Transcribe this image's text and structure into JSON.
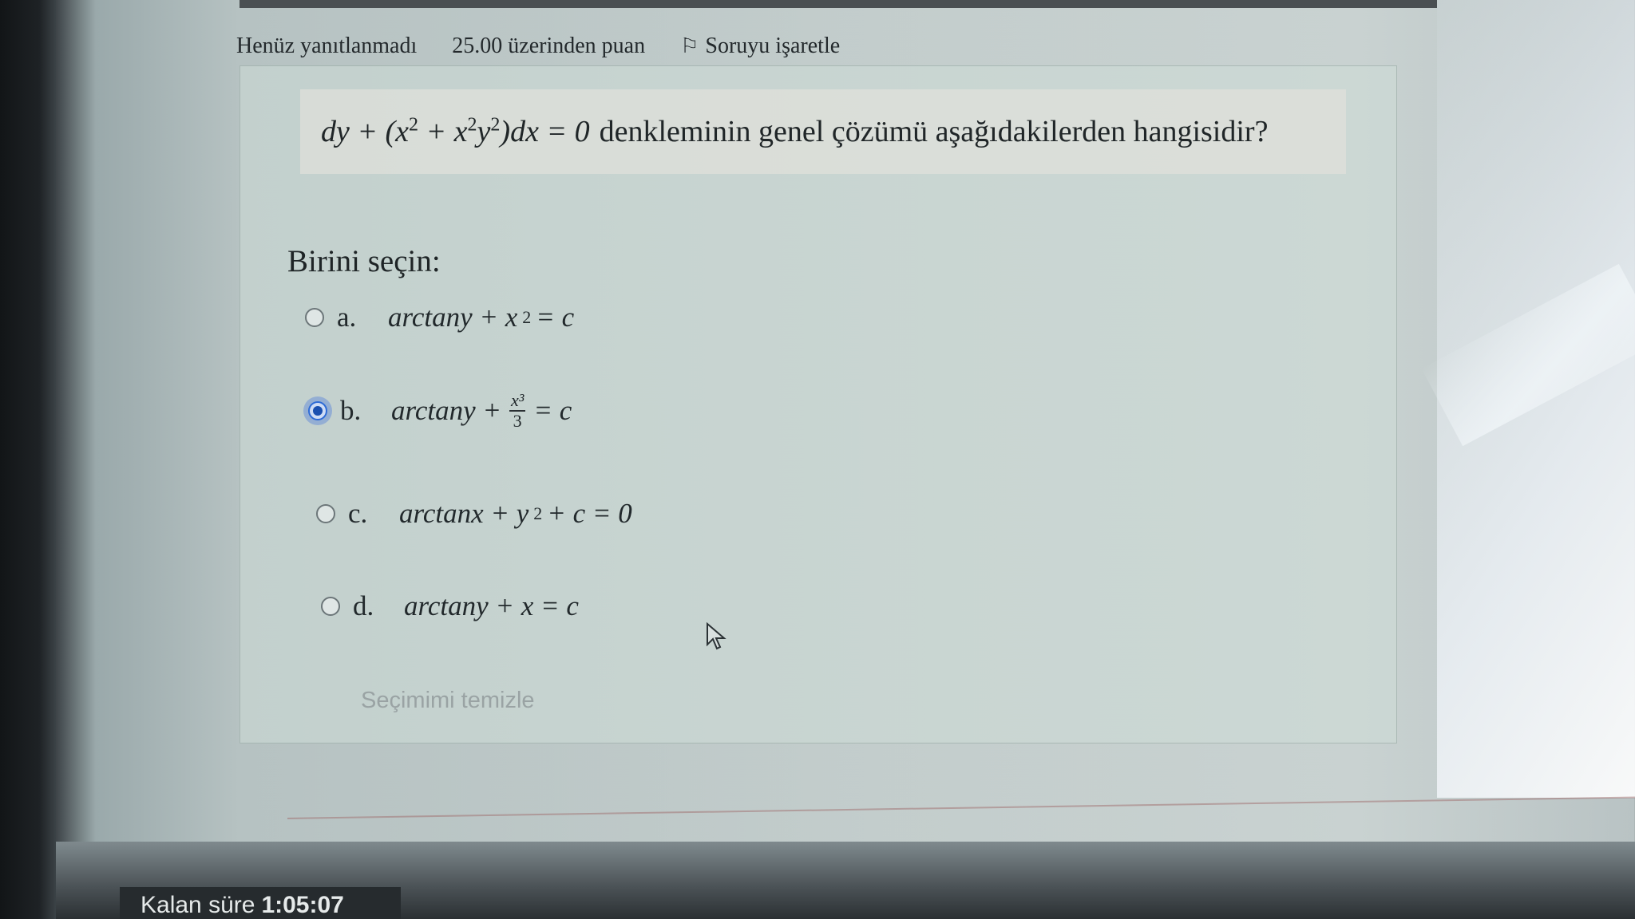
{
  "status_bar": {
    "state": "Henüz yanıtlanmadı",
    "points": "25.00 üzerinden puan",
    "flag_label": "Soruyu işaretle"
  },
  "question": {
    "equation_left": "dy + (x",
    "sup1": "2",
    "eq_mid1": " + x",
    "sup2": "2",
    "eq_mid2": "y",
    "sup3": "2",
    "equation_right": ")dx = 0",
    "text": "denkleminin genel çözümü aşağıdakilerden hangisidir?"
  },
  "prompt": "Birini seçin:",
  "options": [
    {
      "letter": "a.",
      "math_prefix": "arctany + x",
      "sup": "2",
      "math_suffix": " = c",
      "selected": false
    },
    {
      "letter": "b.",
      "math_prefix": "arctany +",
      "frac_num": "x³",
      "frac_den": "3",
      "math_suffix": "= c",
      "selected": true
    },
    {
      "letter": "c.",
      "math_prefix": "arctanx + y",
      "sup": "2",
      "math_suffix": " + c = 0",
      "selected": false
    },
    {
      "letter": "d.",
      "math_prefix": "arctany + x = c",
      "selected": false
    }
  ],
  "clear_choice": "Seçimimi temizle",
  "timer": {
    "label": "Kalan süre",
    "value": "1:05:07"
  },
  "colors": {
    "accent": "#2e6bd6",
    "muted_link": "#9aa3a4",
    "timer_bg": "#262b2e"
  }
}
